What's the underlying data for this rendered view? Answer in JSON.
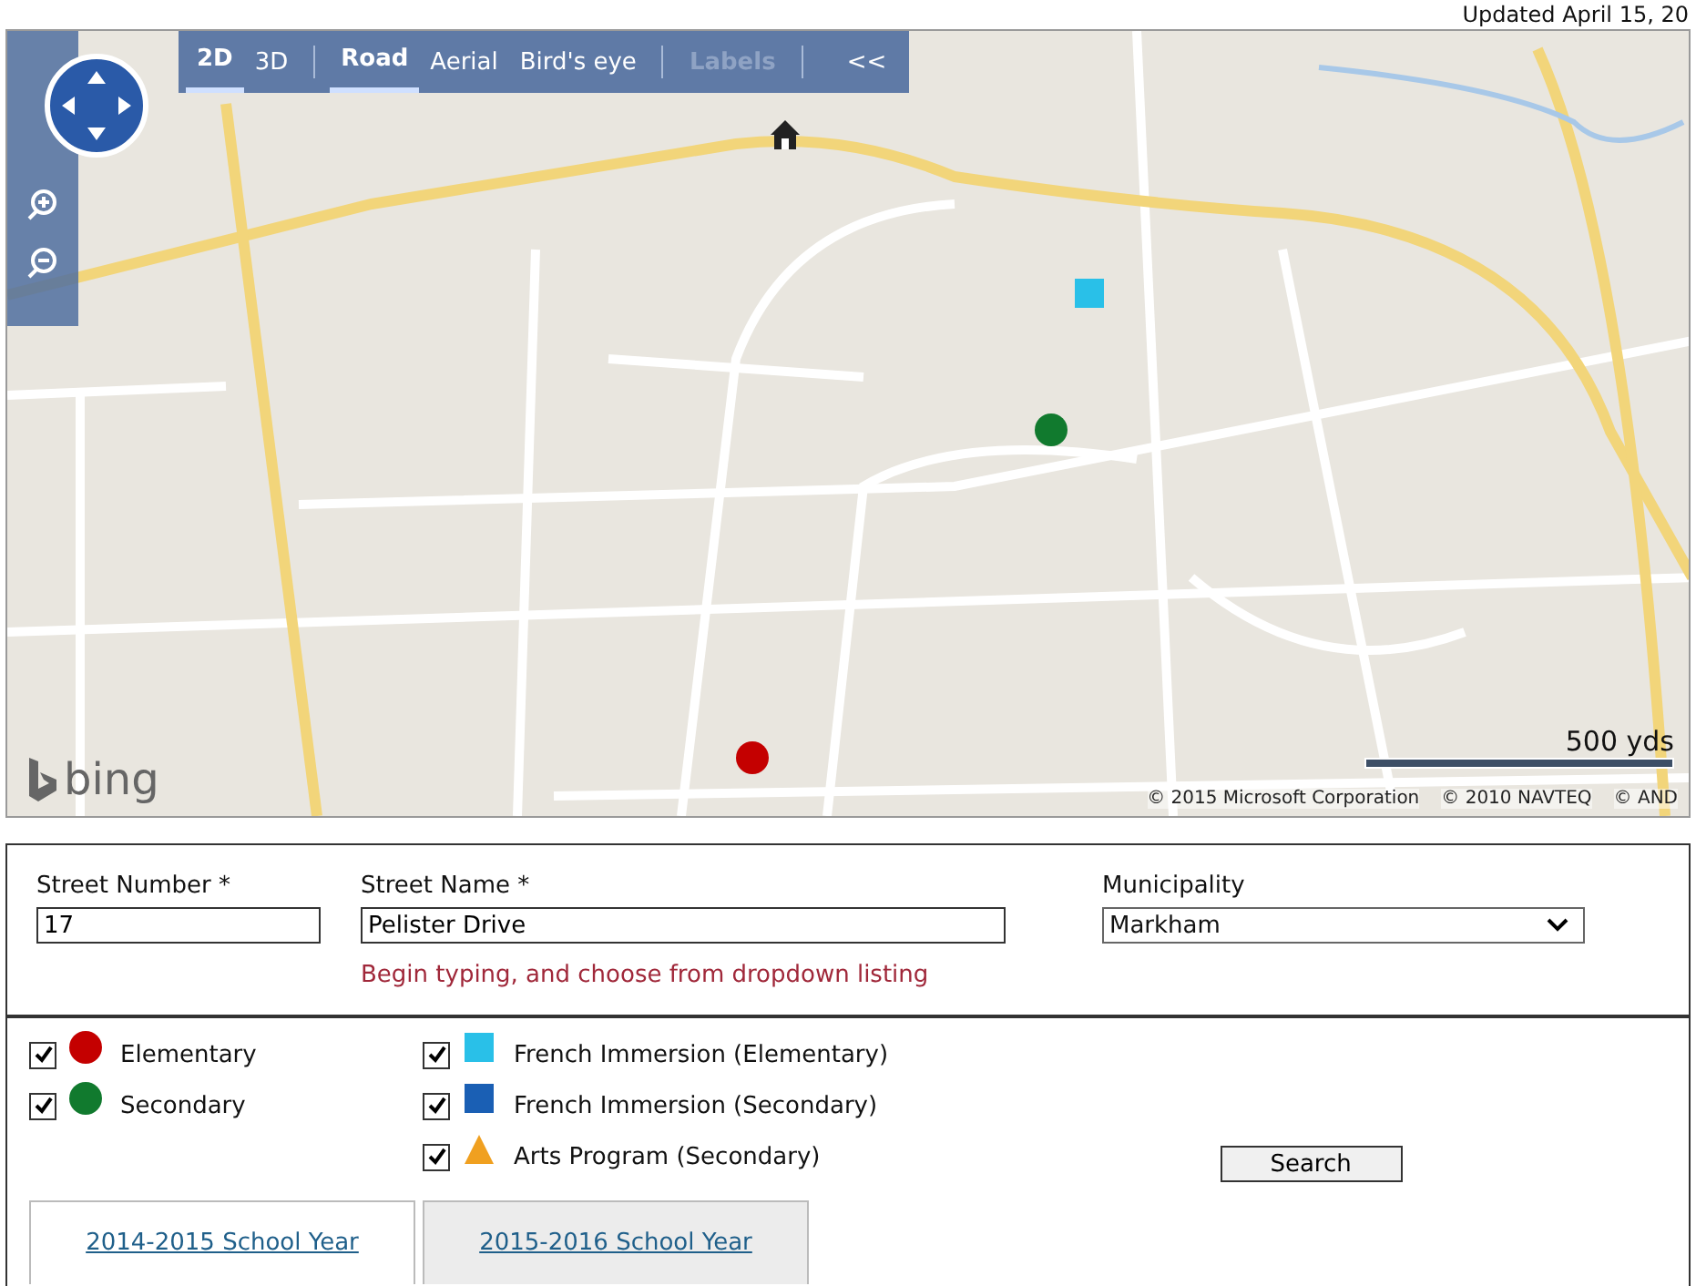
{
  "updated_note": "Updated April 15, 20",
  "map": {
    "toolbar": [
      {
        "label": "2D",
        "kind": "view",
        "selected": true,
        "disabled": false
      },
      {
        "label": "3D",
        "kind": "view",
        "selected": false,
        "disabled": false
      },
      {
        "label": "Road",
        "kind": "style",
        "selected": true,
        "disabled": false
      },
      {
        "label": "Aerial",
        "kind": "style",
        "selected": false,
        "disabled": false
      },
      {
        "label": "Bird's eye",
        "kind": "style",
        "selected": false,
        "disabled": false
      },
      {
        "label": "Labels",
        "kind": "overlay",
        "selected": false,
        "disabled": true
      }
    ],
    "collapse_label": "<<",
    "markers": [
      {
        "kind": "home",
        "color": "#222222"
      },
      {
        "kind": "square",
        "color": "#29c0e8"
      },
      {
        "kind": "circle",
        "color": "#117a2e"
      },
      {
        "kind": "circle",
        "color": "#c40000"
      }
    ],
    "logo": "bing",
    "scale_label": "500 yds",
    "attributions": [
      "© 2015 Microsoft Corporation",
      "© 2010 NAVTEQ",
      "© AND"
    ]
  },
  "search_form": {
    "fields": [
      {
        "kind": "text",
        "label": "Street Number *",
        "value": "17"
      },
      {
        "kind": "text",
        "label": "Street Name *",
        "value": "Pelister Drive",
        "hint": "Begin typing, and choose from dropdown listing"
      },
      {
        "kind": "select",
        "label": "Municipality",
        "value": "Markham"
      }
    ]
  },
  "legend": {
    "columns": [
      [
        {
          "label": "Elementary",
          "kind": "circle",
          "color": "#c40000",
          "checked": true
        },
        {
          "label": "Secondary",
          "kind": "circle",
          "color": "#117a2e",
          "checked": true
        }
      ],
      [
        {
          "label": "French Immersion (Elementary)",
          "kind": "square",
          "color": "#29c0e8",
          "checked": true
        },
        {
          "label": "French Immersion (Secondary)",
          "kind": "square",
          "color": "#1a5fb4",
          "checked": true
        },
        {
          "label": "Arts Program (Secondary)",
          "kind": "triangle",
          "color": "#f0a020",
          "checked": true
        }
      ]
    ],
    "search_button": "Search"
  },
  "tabs": [
    {
      "label": "2014-2015 School Year",
      "selected": true
    },
    {
      "label": "2015-2016 School Year",
      "selected": false
    }
  ]
}
